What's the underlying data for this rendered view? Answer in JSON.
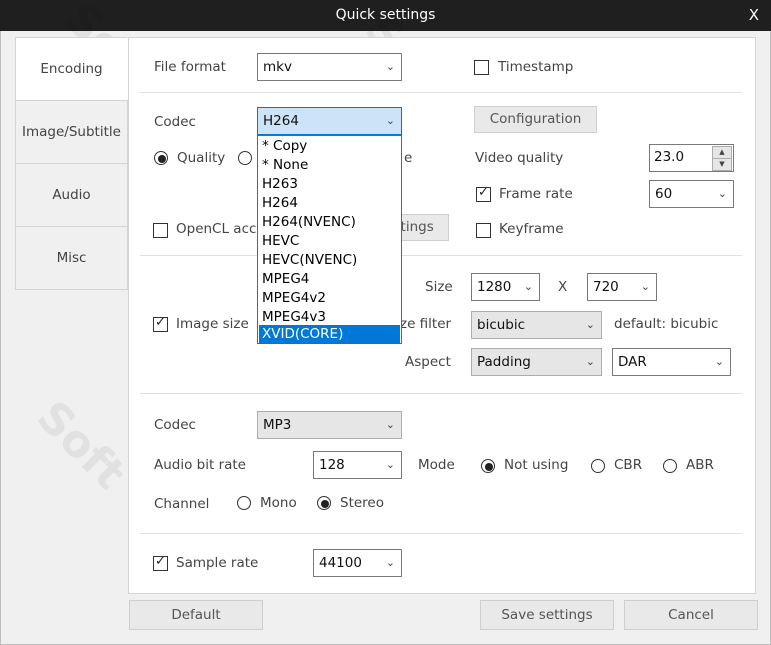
{
  "window": {
    "title": "Quick settings",
    "close_glyph": "X"
  },
  "tabs": [
    "Encoding",
    "Image/Subtitle",
    "Audio",
    "Misc"
  ],
  "video": {
    "file_format_label": "File format",
    "file_format_value": "mkv",
    "timestamp_label": "Timestamp",
    "timestamp_checked": false,
    "codec_label": "Codec",
    "codec_value": "H264",
    "configuration_label": "Configuration",
    "quality_label": "Quality",
    "quality_radio_partial": "e",
    "video_quality_label": "Video quality",
    "video_quality_value": "23.0",
    "frame_rate_label": "Frame rate",
    "frame_rate_checked": true,
    "frame_rate_value": "60",
    "opencl_label": "OpenCL acc",
    "settings_button_partial": "ttings",
    "keyframe_label": "Keyframe",
    "keyframe_checked": false
  },
  "codec_dropdown": {
    "options": [
      "* Copy",
      "* None",
      "H263",
      "H264",
      "H264(NVENC)",
      "HEVC",
      "HEVC(NVENC)",
      "MPEG4",
      "MPEG4v2",
      "MPEG4v3",
      "XVID(CORE)"
    ],
    "highlighted": "XVID(CORE)"
  },
  "image": {
    "image_size_label": "Image size",
    "image_size_checked": true,
    "size_label": "Size",
    "width_value": "1280",
    "x_label": "X",
    "height_value": "720",
    "resize_filter_label_partial": "ze filter",
    "resize_filter_value": "bicubic",
    "resize_filter_default": "default: bicubic",
    "aspect_label": "Aspect",
    "aspect_value": "Padding",
    "aspect_mode_value": "DAR"
  },
  "audio": {
    "codec_label": "Codec",
    "codec_value": "MP3",
    "bit_rate_label": "Audio bit rate",
    "bit_rate_value": "128",
    "mode_label": "Mode",
    "mode_options": [
      "Not using",
      "CBR",
      "ABR"
    ],
    "mode_selected": "Not using",
    "channel_label": "Channel",
    "channel_options": [
      "Mono",
      "Stereo"
    ],
    "channel_selected": "Stereo",
    "sample_rate_label": "Sample rate",
    "sample_rate_checked": true,
    "sample_rate_value": "44100"
  },
  "footer": {
    "default_label": "Default",
    "save_label": "Save settings",
    "cancel_label": "Cancel"
  }
}
